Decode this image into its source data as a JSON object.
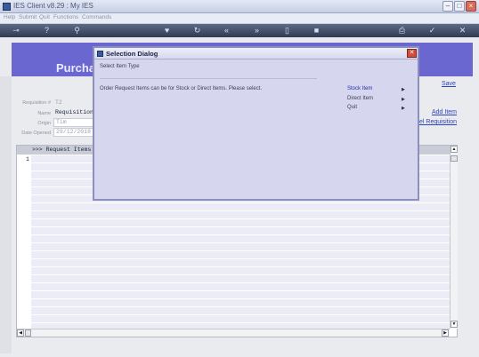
{
  "window": {
    "title": "IES Client v8.29 : My IES",
    "menu": [
      "Help",
      "Submit",
      "Quit",
      "Functions",
      "Commands"
    ]
  },
  "toolbar": {
    "icons": [
      "key-icon",
      "help-icon",
      "search-icon",
      "heart-icon",
      "refresh-icon",
      "rewind-icon",
      "fast-forward-icon",
      "document-icon",
      "page-icon",
      "printer-icon",
      "check-icon",
      "close-icon"
    ]
  },
  "page": {
    "title": "Purcha",
    "save_link": "Save",
    "add_item_link": "Add Item",
    "del_requisition_link": "el Requisition",
    "requisition_label": "Requisition #",
    "requisition_value": "T2",
    "name_label": "Name",
    "name_value": "Requisition",
    "origin_label": "Origin",
    "origin_value": "Tim",
    "date_opened_label": "Date Opened",
    "date_opened_value": "29/12/2018"
  },
  "grid": {
    "header": ">>> Request Items",
    "row_number": "1",
    "row_count": 22
  },
  "dialog": {
    "title": "Selection Dialog",
    "heading": "Select Item Type",
    "message": "Order Request Items can be for Stock or Direct Items. Please select.",
    "options": [
      "Stock Item",
      "Direct Item",
      "Quit"
    ]
  },
  "colors": {
    "header_band": "#6b67d0",
    "dialog_bg": "#d6d6ef",
    "link": "#2f43b8"
  }
}
